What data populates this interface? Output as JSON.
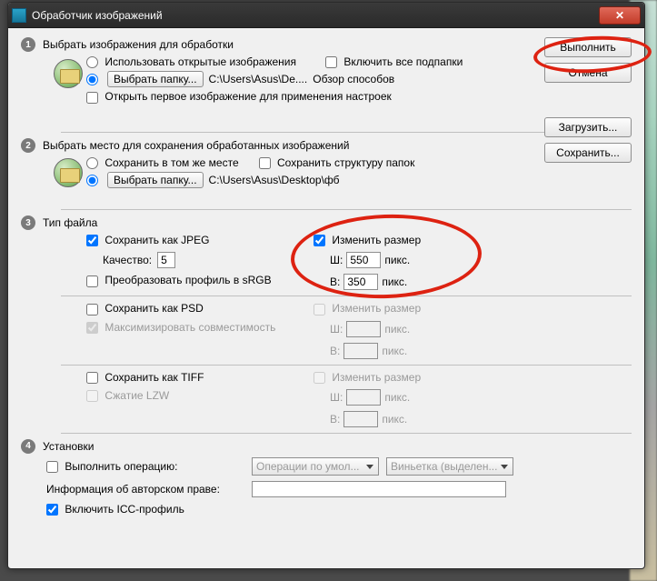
{
  "window": {
    "title": "Обработчик изображений"
  },
  "buttons": {
    "run": "Выполнить",
    "cancel": "Отмена",
    "load": "Загрузить...",
    "save": "Сохранить..."
  },
  "section1": {
    "num": "1",
    "title": "Выбрать изображения для обработки",
    "useOpen": "Использовать открытые изображения",
    "includeSub": "Включить все подпапки",
    "selectFolder": "Выбрать папку...",
    "path": "C:\\Users\\Asus\\De....",
    "browse": "Обзор способов",
    "openFirst": "Открыть первое изображение для применения настроек"
  },
  "section2": {
    "num": "2",
    "title": "Выбрать место для сохранения обработанных изображений",
    "sameLoc": "Сохранить в том же месте",
    "keepStruct": "Сохранить структуру папок",
    "selectFolder": "Выбрать папку...",
    "path": "C:\\Users\\Asus\\Desktop\\фб"
  },
  "section3": {
    "num": "3",
    "title": "Тип файла",
    "jpeg": {
      "saveAs": "Сохранить как JPEG",
      "qualityLabel": "Качество:",
      "quality": "5",
      "convert": "Преобразовать профиль в sRGB",
      "resize": "Изменить размер",
      "wLabel": "Ш:",
      "w": "550",
      "hLabel": "В:",
      "h": "350",
      "px": "пикс."
    },
    "psd": {
      "saveAs": "Сохранить как PSD",
      "maxCompat": "Максимизировать совместимость",
      "resize": "Изменить размер",
      "wLabel": "Ш:",
      "hLabel": "В:",
      "px": "пикс."
    },
    "tiff": {
      "saveAs": "Сохранить как TIFF",
      "lzw": "Сжатие LZW",
      "resize": "Изменить размер",
      "wLabel": "Ш:",
      "hLabel": "В:",
      "px": "пикс."
    }
  },
  "section4": {
    "num": "4",
    "title": "Установки",
    "runAction": "Выполнить операцию:",
    "actionSet": "Операции по умол...",
    "action": "Виньетка (выделен...",
    "copyright": "Информация об авторском праве:",
    "icc": "Включить ICC-профиль"
  }
}
